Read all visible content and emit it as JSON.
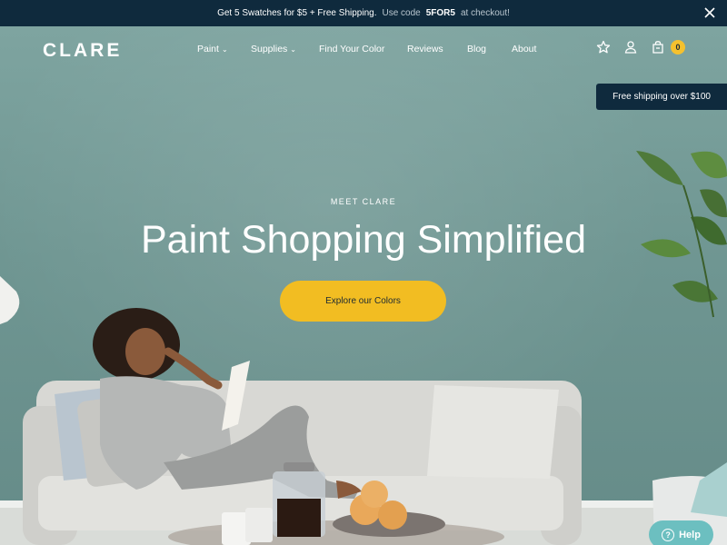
{
  "promo": {
    "message": "Get 5 Swatches for $5 + Free Shipping.",
    "code_prefix": "Use code",
    "code": "5FOR5",
    "code_suffix": "at checkout!"
  },
  "brand": {
    "logo": "CLARE"
  },
  "nav": {
    "items": [
      {
        "label": "Paint",
        "has_dropdown": true
      },
      {
        "label": "Supplies",
        "has_dropdown": true
      },
      {
        "label": "Find Your Color",
        "has_dropdown": false
      },
      {
        "label": "Reviews",
        "has_dropdown": false
      },
      {
        "label": "Blog",
        "has_dropdown": false
      },
      {
        "label": "About",
        "has_dropdown": false
      }
    ],
    "icons": [
      "star-icon",
      "account-icon",
      "cart-icon"
    ],
    "cart_count": "0"
  },
  "shipping_tab": "Free shipping over $100",
  "hero": {
    "eyebrow": "MEET CLARE",
    "headline": "Paint Shopping Simplified",
    "cta": "Explore our Colors"
  },
  "help": {
    "label": "Help"
  },
  "colors": {
    "navy": "#0f2a3d",
    "wall_teal": "#6f9592",
    "accent_yellow": "#f2bd22",
    "help_teal": "#6cbfc0"
  }
}
